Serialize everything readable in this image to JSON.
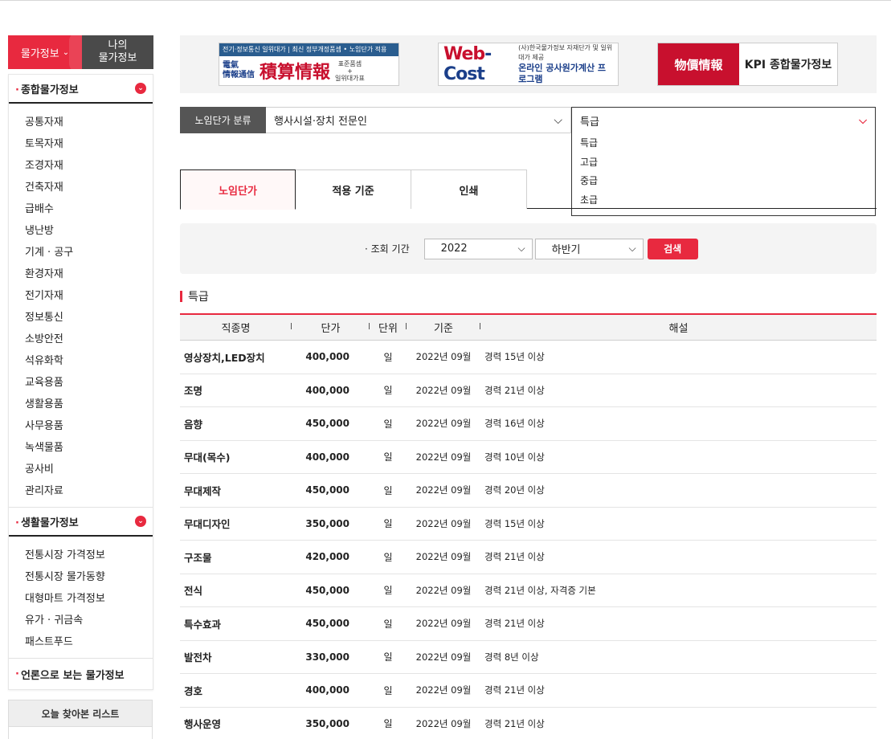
{
  "sidebar": {
    "tab_active": "물가정보",
    "tab_inactive": "나의\n물가정보",
    "section1": {
      "title": "종합물가정보",
      "items": [
        "공통자재",
        "토목자재",
        "조경자재",
        "건축자재",
        "급배수",
        "냉난방",
        "기계 · 공구",
        "환경자재",
        "전기자재",
        "정보통신",
        "소방안전",
        "석유화학",
        "교육용품",
        "생활용품",
        "사무용품",
        "녹색물품",
        "공사비",
        "관리자료"
      ]
    },
    "section2": {
      "title": "생활물가정보",
      "items": [
        "전통시장 가격정보",
        "전통시장 물가동향",
        "대형마트 가격정보",
        "유가 · 귀금속",
        "패스트푸드"
      ]
    },
    "section3": {
      "title": "언론으로 보는 물가정보"
    },
    "recent": "오늘 찾아본 리스트"
  },
  "banner": {
    "ad1": {
      "strip": "전기·정보통신 일위대가 | 최신 정부개정품셈 • 노임단가 적용",
      "small1": "電氣",
      "small2": "情報通信",
      "big": "積算情報",
      "tiny": "표준품셈\n+\n일위대가표"
    },
    "ad2": {
      "logo_a": "Web",
      "logo_b": "-Cost",
      "line1": "(사)한국물가정보 자재단가 및 일위대가 제공",
      "line2": "온라인 공사원가계산 프로그램"
    },
    "ad3": {
      "left": "物價情報",
      "right": "KPI 종합물가정보"
    }
  },
  "filter": {
    "label": "노임단가 분류",
    "category": "행사시설·장치 전문인",
    "grade": "특급",
    "grade_options": [
      "특급",
      "고급",
      "중급",
      "초급"
    ]
  },
  "tabs": [
    "노임단가",
    "적용 기준",
    "인쇄"
  ],
  "search": {
    "label": "· 조회 기간",
    "year": "2022",
    "half": "하반기",
    "button": "검색"
  },
  "section_title": "특급",
  "table": {
    "headers": [
      "직종명",
      "단가",
      "단위",
      "기준",
      "해설"
    ],
    "rows": [
      {
        "name": "영상장치,LED장치",
        "price": "400,000",
        "unit": "일",
        "base": "2022년 09월",
        "desc": "경력 15년 이상"
      },
      {
        "name": "조명",
        "price": "400,000",
        "unit": "일",
        "base": "2022년 09월",
        "desc": "경력 21년 이상"
      },
      {
        "name": "음향",
        "price": "450,000",
        "unit": "일",
        "base": "2022년 09월",
        "desc": "경력 16년 이상"
      },
      {
        "name": "무대(목수)",
        "price": "400,000",
        "unit": "일",
        "base": "2022년 09월",
        "desc": "경력 10년 이상"
      },
      {
        "name": "무대제작",
        "price": "450,000",
        "unit": "일",
        "base": "2022년 09월",
        "desc": "경력 20년 이상"
      },
      {
        "name": "무대디자인",
        "price": "350,000",
        "unit": "일",
        "base": "2022년 09월",
        "desc": "경력 15년 이상"
      },
      {
        "name": "구조물",
        "price": "420,000",
        "unit": "일",
        "base": "2022년 09월",
        "desc": "경력 21년 이상"
      },
      {
        "name": "전식",
        "price": "450,000",
        "unit": "일",
        "base": "2022년 09월",
        "desc": "경력 21년 이상, 자격증 기본"
      },
      {
        "name": "특수효과",
        "price": "450,000",
        "unit": "일",
        "base": "2022년 09월",
        "desc": "경력 21년 이상"
      },
      {
        "name": "발전차",
        "price": "330,000",
        "unit": "일",
        "base": "2022년 09월",
        "desc": "경력 8년 이상"
      },
      {
        "name": "경호",
        "price": "400,000",
        "unit": "일",
        "base": "2022년 09월",
        "desc": "경력 21년 이상"
      },
      {
        "name": "행사운영",
        "price": "350,000",
        "unit": "일",
        "base": "2022년 09월",
        "desc": "경력 21년 이상"
      }
    ]
  },
  "colors": {
    "accent": "#e8293f",
    "dark_tab": "#4a4a4a",
    "label_bg": "#555555"
  }
}
